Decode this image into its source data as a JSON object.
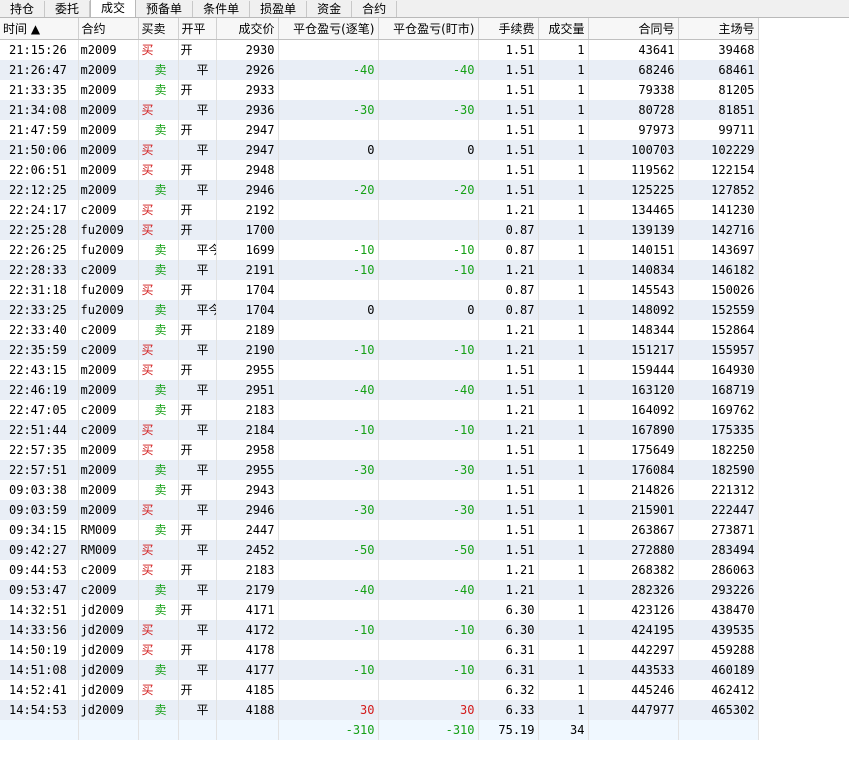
{
  "tabs": [
    "持仓",
    "委托",
    "成交",
    "预备单",
    "条件单",
    "损盈单",
    "资金",
    "合约"
  ],
  "active_tab": 2,
  "columns": [
    "时间 ▲",
    "合约",
    "买卖",
    "开平",
    "成交价",
    "平仓盈亏(逐笔)",
    "平仓盈亏(盯市)",
    "手续费",
    "成交量",
    "合同号",
    "主场号"
  ],
  "rows": [
    [
      "21:15:26",
      "m2009",
      "买",
      "开",
      "2930",
      "",
      "",
      "1.51",
      "1",
      "43641",
      "39468"
    ],
    [
      "21:26:47",
      "m2009",
      "卖",
      "平",
      "2926",
      "-40",
      "-40",
      "1.51",
      "1",
      "68246",
      "68461"
    ],
    [
      "21:33:35",
      "m2009",
      "卖",
      "开",
      "2933",
      "",
      "",
      "1.51",
      "1",
      "79338",
      "81205"
    ],
    [
      "21:34:08",
      "m2009",
      "买",
      "平",
      "2936",
      "-30",
      "-30",
      "1.51",
      "1",
      "80728",
      "81851"
    ],
    [
      "21:47:59",
      "m2009",
      "卖",
      "开",
      "2947",
      "",
      "",
      "1.51",
      "1",
      "97973",
      "99711"
    ],
    [
      "21:50:06",
      "m2009",
      "买",
      "平",
      "2947",
      "0",
      "0",
      "1.51",
      "1",
      "100703",
      "102229"
    ],
    [
      "22:06:51",
      "m2009",
      "买",
      "开",
      "2948",
      "",
      "",
      "1.51",
      "1",
      "119562",
      "122154"
    ],
    [
      "22:12:25",
      "m2009",
      "卖",
      "平",
      "2946",
      "-20",
      "-20",
      "1.51",
      "1",
      "125225",
      "127852"
    ],
    [
      "22:24:17",
      "c2009",
      "买",
      "开",
      "2192",
      "",
      "",
      "1.21",
      "1",
      "134465",
      "141230"
    ],
    [
      "22:25:28",
      "fu2009",
      "买",
      "开",
      "1700",
      "",
      "",
      "0.87",
      "1",
      "139139",
      "142716"
    ],
    [
      "22:26:25",
      "fu2009",
      "卖",
      "平今",
      "1699",
      "-10",
      "-10",
      "0.87",
      "1",
      "140151",
      "143697"
    ],
    [
      "22:28:33",
      "c2009",
      "卖",
      "平",
      "2191",
      "-10",
      "-10",
      "1.21",
      "1",
      "140834",
      "146182"
    ],
    [
      "22:31:18",
      "fu2009",
      "买",
      "开",
      "1704",
      "",
      "",
      "0.87",
      "1",
      "145543",
      "150026"
    ],
    [
      "22:33:25",
      "fu2009",
      "卖",
      "平今",
      "1704",
      "0",
      "0",
      "0.87",
      "1",
      "148092",
      "152559"
    ],
    [
      "22:33:40",
      "c2009",
      "卖",
      "开",
      "2189",
      "",
      "",
      "1.21",
      "1",
      "148344",
      "152864"
    ],
    [
      "22:35:59",
      "c2009",
      "买",
      "平",
      "2190",
      "-10",
      "-10",
      "1.21",
      "1",
      "151217",
      "155957"
    ],
    [
      "22:43:15",
      "m2009",
      "买",
      "开",
      "2955",
      "",
      "",
      "1.51",
      "1",
      "159444",
      "164930"
    ],
    [
      "22:46:19",
      "m2009",
      "卖",
      "平",
      "2951",
      "-40",
      "-40",
      "1.51",
      "1",
      "163120",
      "168719"
    ],
    [
      "22:47:05",
      "c2009",
      "卖",
      "开",
      "2183",
      "",
      "",
      "1.21",
      "1",
      "164092",
      "169762"
    ],
    [
      "22:51:44",
      "c2009",
      "买",
      "平",
      "2184",
      "-10",
      "-10",
      "1.21",
      "1",
      "167890",
      "175335"
    ],
    [
      "22:57:35",
      "m2009",
      "买",
      "开",
      "2958",
      "",
      "",
      "1.51",
      "1",
      "175649",
      "182250"
    ],
    [
      "22:57:51",
      "m2009",
      "卖",
      "平",
      "2955",
      "-30",
      "-30",
      "1.51",
      "1",
      "176084",
      "182590"
    ],
    [
      "09:03:38",
      "m2009",
      "卖",
      "开",
      "2943",
      "",
      "",
      "1.51",
      "1",
      "214826",
      "221312"
    ],
    [
      "09:03:59",
      "m2009",
      "买",
      "平",
      "2946",
      "-30",
      "-30",
      "1.51",
      "1",
      "215901",
      "222447"
    ],
    [
      "09:34:15",
      "RM009",
      "卖",
      "开",
      "2447",
      "",
      "",
      "1.51",
      "1",
      "263867",
      "273871"
    ],
    [
      "09:42:27",
      "RM009",
      "买",
      "平",
      "2452",
      "-50",
      "-50",
      "1.51",
      "1",
      "272880",
      "283494"
    ],
    [
      "09:44:53",
      "c2009",
      "买",
      "开",
      "2183",
      "",
      "",
      "1.21",
      "1",
      "268382",
      "286063"
    ],
    [
      "09:53:47",
      "c2009",
      "卖",
      "平",
      "2179",
      "-40",
      "-40",
      "1.21",
      "1",
      "282326",
      "293226"
    ],
    [
      "14:32:51",
      "jd2009",
      "卖",
      "开",
      "4171",
      "",
      "",
      "6.30",
      "1",
      "423126",
      "438470"
    ],
    [
      "14:33:56",
      "jd2009",
      "买",
      "平",
      "4172",
      "-10",
      "-10",
      "6.30",
      "1",
      "424195",
      "439535"
    ],
    [
      "14:50:19",
      "jd2009",
      "买",
      "开",
      "4178",
      "",
      "",
      "6.31",
      "1",
      "442297",
      "459288"
    ],
    [
      "14:51:08",
      "jd2009",
      "卖",
      "平",
      "4177",
      "-10",
      "-10",
      "6.31",
      "1",
      "443533",
      "460189"
    ],
    [
      "14:52:41",
      "jd2009",
      "买",
      "开",
      "4185",
      "",
      "",
      "6.32",
      "1",
      "445246",
      "462412"
    ],
    [
      "14:54:53",
      "jd2009",
      "卖",
      "平",
      "4188",
      "30",
      "30",
      "6.33",
      "1",
      "447977",
      "465302"
    ]
  ],
  "totals": {
    "pnl_trade": "-310",
    "pnl_mark": "-310",
    "fee": "75.19",
    "volume": "34"
  },
  "colors": {
    "buy": "#d21a1a",
    "sell": "#16a016",
    "row_alt": "#e9eef6"
  }
}
